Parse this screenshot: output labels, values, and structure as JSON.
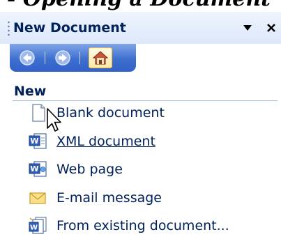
{
  "cut_heading": "- Opening a Document",
  "pane": {
    "title": "New Document",
    "menu_icon": "dropdown-arrow-icon",
    "close_icon": "close-icon"
  },
  "nav": {
    "back_icon": "back-arrow-icon",
    "forward_icon": "forward-arrow-icon",
    "home_icon": "home-icon"
  },
  "section": {
    "heading": "New"
  },
  "items": [
    {
      "label": "Blank document",
      "icon": "blank-document-icon"
    },
    {
      "label": "XML document",
      "icon": "xml-document-icon"
    },
    {
      "label": "Web page",
      "icon": "web-page-icon"
    },
    {
      "label": "E-mail message",
      "icon": "envelope-icon"
    },
    {
      "label": "From existing document...",
      "icon": "existing-document-icon"
    }
  ],
  "colors": {
    "text": "#00215a",
    "nav_bar": "#3d6fd0",
    "title_bar": "#dce8fb"
  }
}
